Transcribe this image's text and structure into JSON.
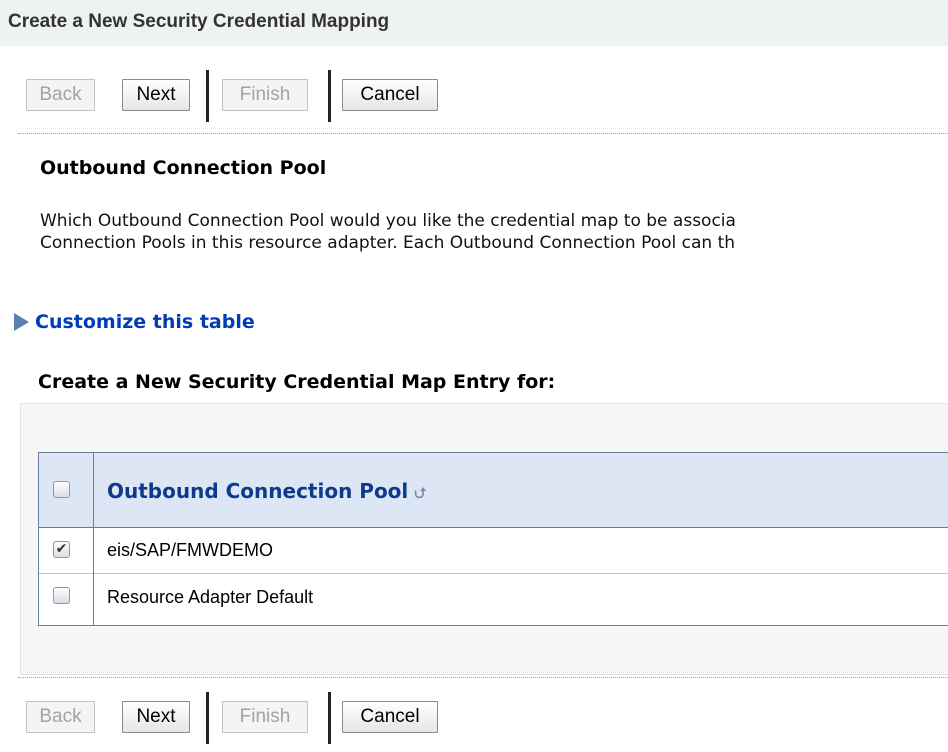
{
  "page": {
    "title": "Create a New Security Credential Mapping"
  },
  "buttons": {
    "back": "Back",
    "next": "Next",
    "finish": "Finish",
    "cancel": "Cancel"
  },
  "section": {
    "title": "Outbound Connection Pool",
    "description_line1": "Which Outbound Connection Pool would you like the credential map to be associa",
    "description_line2": "Connection Pools in this resource adapter. Each Outbound Connection Pool can th"
  },
  "customize": {
    "label": "Customize this table",
    "icon": "disclosure-triangle-icon"
  },
  "table": {
    "caption": "Create a New Security Credential Map Entry for:",
    "column_header": "Outbound Connection Pool",
    "sort_icon": "sort-ascending-icon",
    "rows": [
      {
        "name": "eis/SAP/FMWDEMO",
        "checked": true
      },
      {
        "name": "Resource Adapter Default",
        "checked": false
      }
    ]
  },
  "colors": {
    "title_bar_bg": "#eff2f2",
    "link": "#003cb8",
    "table_header_bg": "#dce6f4",
    "table_header_text": "#0e3a8e"
  }
}
